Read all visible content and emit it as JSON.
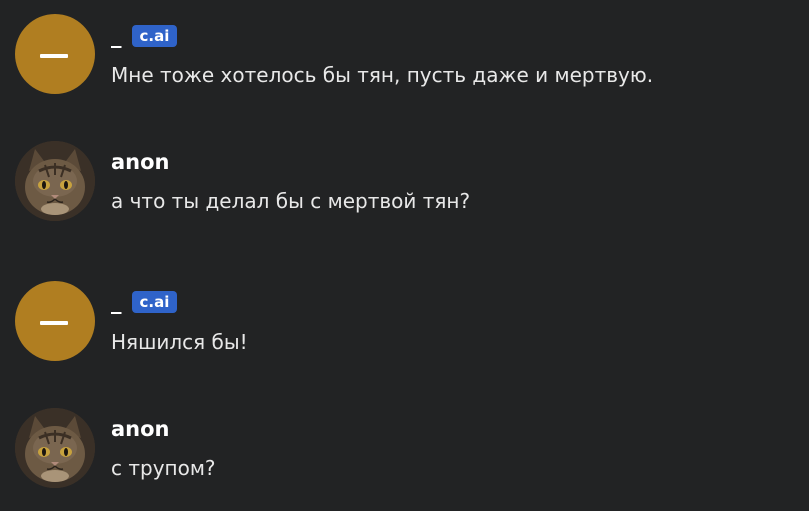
{
  "messages": [
    {
      "username": "_",
      "badge": "c.ai",
      "text": "Мне тоже хотелось бы тян, пусть даже и мертвую."
    },
    {
      "username": "anon",
      "badge": "",
      "text": "а что ты делал бы с мертвой тян?"
    },
    {
      "username": "_",
      "badge": "c.ai",
      "text": "Няшился бы!"
    },
    {
      "username": "anon",
      "badge": "",
      "text": "с трупом?"
    }
  ],
  "colors": {
    "background": "#222324",
    "bot_avatar": "#b07e21",
    "badge": "#2f63c9"
  }
}
